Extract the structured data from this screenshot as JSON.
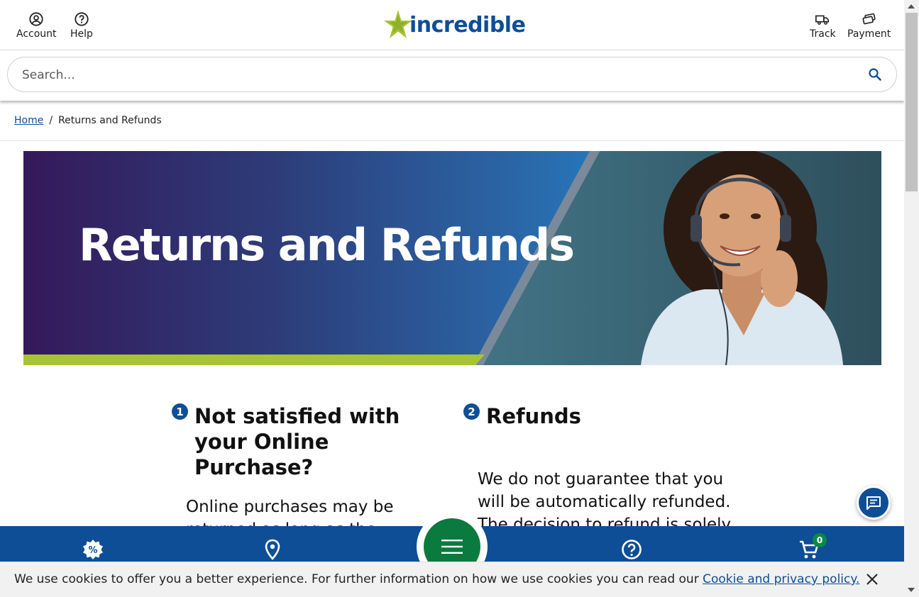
{
  "header": {
    "account_label": "Account",
    "help_label": "Help",
    "brand": "incredible",
    "track_label": "Track",
    "payment_label": "Payment"
  },
  "search": {
    "placeholder": "Search..."
  },
  "breadcrumb": {
    "home": "Home",
    "separator": "/",
    "current": "Returns and Refunds"
  },
  "banner": {
    "title": "Returns and Refunds"
  },
  "sections": [
    {
      "number": "1",
      "title_lines": [
        "Not satisfied with",
        "your Online",
        "Purchase?"
      ],
      "body_lines": [
        "Online purchases may be",
        "returned as long as the"
      ]
    },
    {
      "number": "2",
      "title_lines": [
        "Refunds"
      ],
      "body_lines": [
        "We do not guarantee that you",
        "will be automatically refunded.",
        "The decision to refund is solely"
      ]
    }
  ],
  "bottom_nav": {
    "cart_count": "0",
    "icons": [
      "promo-icon",
      "location-icon",
      "menu-icon",
      "help-icon",
      "cart-icon"
    ]
  },
  "cookie": {
    "text": "We use cookies to offer you a better experience. For further information on how we use cookies you can read our ",
    "link": "Cookie and privacy policy."
  },
  "colors": {
    "brand_blue": "#0e4e96",
    "brand_green": "#a6c436",
    "menu_green": "#0b7a3e"
  }
}
